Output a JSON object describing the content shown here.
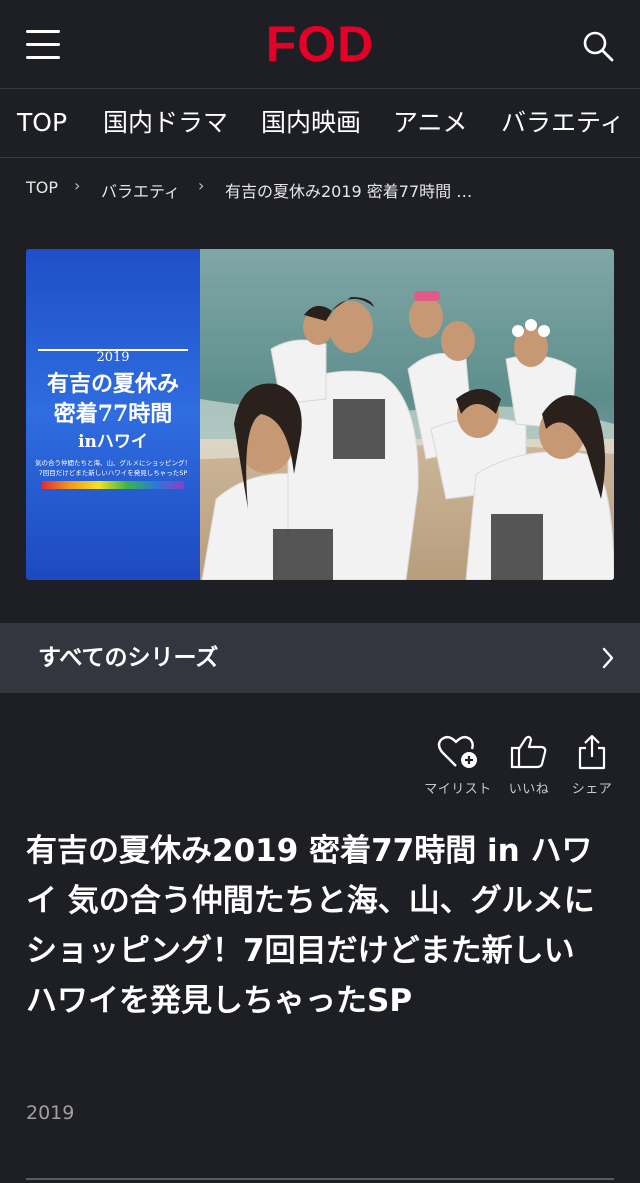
{
  "header": {
    "logo": "FOD"
  },
  "nav": {
    "items": [
      "TOP",
      "国内ドラマ",
      "国内映画",
      "アニメ",
      "バラエティ"
    ]
  },
  "breadcrumb": {
    "items": [
      "TOP",
      "バラエティ",
      "有吉の夏休み2019 密着77時間 …"
    ]
  },
  "hero": {
    "panel_year": "2019",
    "panel_line1": "有吉の夏休み",
    "panel_line2": "密着77時間",
    "panel_line3": "inハワイ",
    "panel_sub1": "気の合う仲間たちと海、山、グルメにショッピング！",
    "panel_sub2": "7回目だけどまた新しいハワイを発見しちゃったSP"
  },
  "series": {
    "label": "すべてのシリーズ"
  },
  "actions": {
    "mylist": "マイリスト",
    "like": "いいね",
    "share": "シェア"
  },
  "program": {
    "title": "有吉の夏休み2019 密着77時間 in ハワイ 気の合う仲間たちと海、山、グルメにショッピング！7回目だけどまた新しいハワイを発見しちゃったSP",
    "year": "2019"
  },
  "colors": {
    "brand": "#e60028",
    "background": "#1e1f25",
    "series_bar": "#34363f"
  }
}
